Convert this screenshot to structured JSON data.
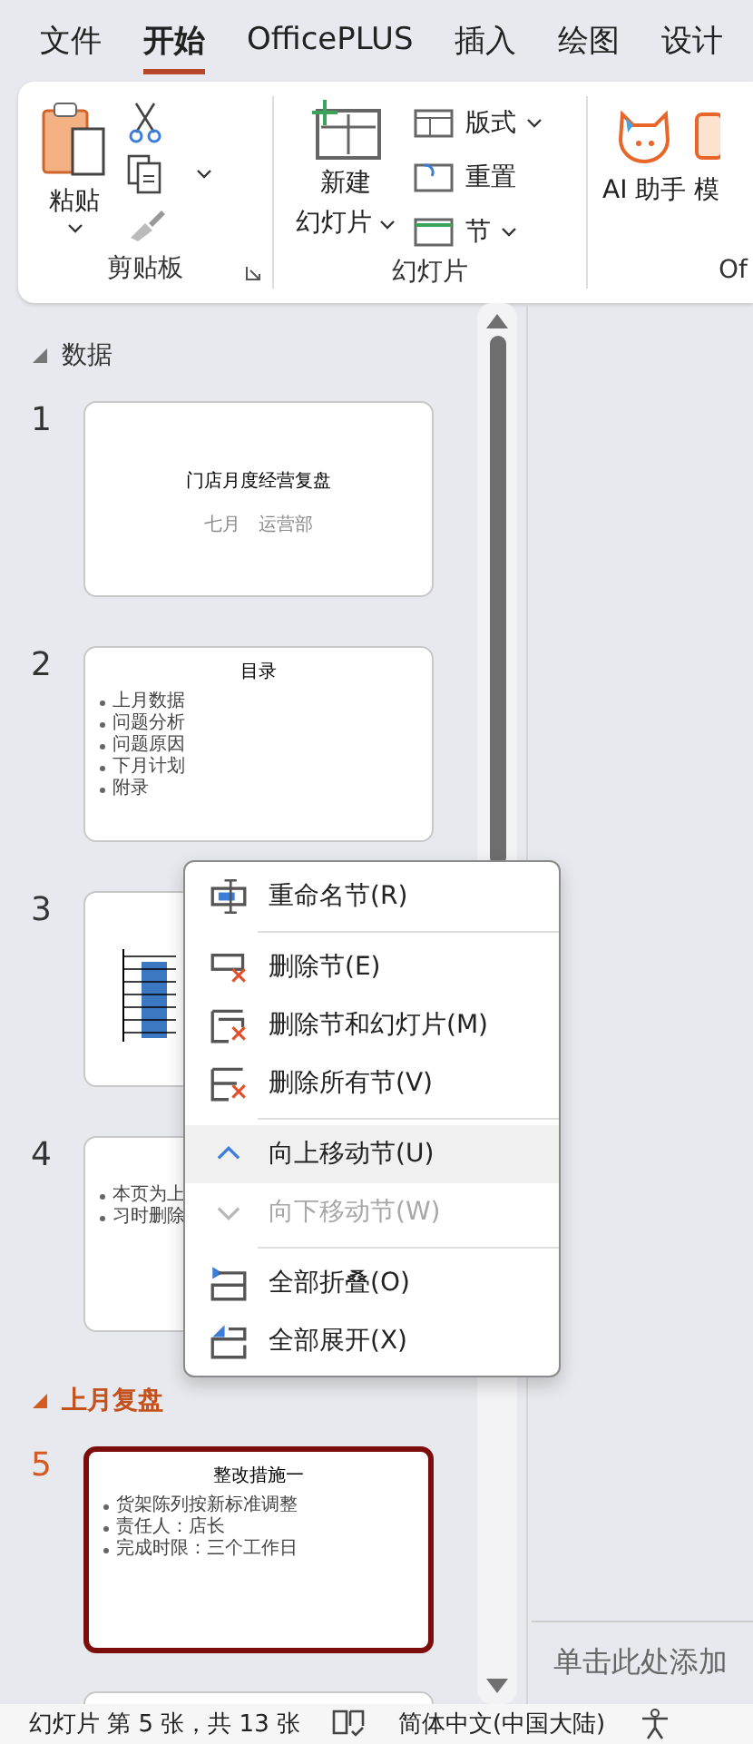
{
  "tabs": [
    {
      "label": "文件",
      "selected": false
    },
    {
      "label": "开始",
      "selected": true
    },
    {
      "label": "OfficePLUS",
      "selected": false
    },
    {
      "label": "插入",
      "selected": false
    },
    {
      "label": "绘图",
      "selected": false
    },
    {
      "label": "设计",
      "selected": false
    }
  ],
  "ribbon": {
    "groups": [
      {
        "kind": "clipboard",
        "label": "剪贴板",
        "paste": "粘贴"
      },
      {
        "kind": "slides",
        "label": "幻灯片",
        "new_slide": [
          "新建",
          "幻灯片"
        ],
        "buttons": [
          "版式",
          "重置",
          "节"
        ]
      },
      {
        "kind": "ai",
        "label": "Of",
        "buttons": [
          "AI 助手",
          "模"
        ]
      }
    ]
  },
  "sections": [
    {
      "name": "数据",
      "selected": false,
      "slides": [
        {
          "number": "1",
          "kind": "title",
          "selected": false,
          "title": "门店月度经营复盘",
          "subtitle": "七月　运营部"
        },
        {
          "number": "2",
          "kind": "list",
          "selected": false,
          "title": "目录",
          "bullets": [
            "上月数据",
            "问题分析",
            "问题原因",
            "下月计划",
            "附录"
          ]
        },
        {
          "number": "3",
          "kind": "chart",
          "selected": false
        },
        {
          "number": "4",
          "kind": "note",
          "selected": false,
          "lines": [
            "本页为上",
            "习时删除"
          ]
        }
      ]
    },
    {
      "name": "上月复盘",
      "selected": true,
      "slides": [
        {
          "number": "5",
          "kind": "list",
          "selected": true,
          "title": "整改措施一",
          "bullets": [
            "货架陈列按新标准调整",
            "责任人：店长",
            "完成时限：三个工作日"
          ]
        },
        {
          "kind": "blank",
          "selected": false
        }
      ]
    }
  ],
  "context_menu": {
    "groups": [
      [
        {
          "kind": "rename",
          "label": "重命名节(R)",
          "disabled": false,
          "highlighted": false
        }
      ],
      [
        {
          "kind": "delete",
          "label": "删除节(E)",
          "disabled": false,
          "highlighted": false
        },
        {
          "kind": "delete-with-slides",
          "label": "删除节和幻灯片(M)",
          "disabled": false,
          "highlighted": false
        },
        {
          "kind": "delete-all",
          "label": "删除所有节(V)",
          "disabled": false,
          "highlighted": false
        }
      ],
      [
        {
          "kind": "up",
          "label": "向上移动节(U)",
          "disabled": false,
          "highlighted": true
        },
        {
          "kind": "down",
          "label": "向下移动节(W)",
          "disabled": true,
          "highlighted": false
        }
      ],
      [
        {
          "kind": "collapse",
          "label": "全部折叠(O)",
          "disabled": false,
          "highlighted": false
        },
        {
          "kind": "expand",
          "label": "全部展开(X)",
          "disabled": false,
          "highlighted": false
        }
      ]
    ]
  },
  "notes": {
    "placeholder": "单击此处添加"
  },
  "status_bar": {
    "slide_info": "幻灯片 第 5 张，共 13 张",
    "language": "简体中文(中国大陆)"
  }
}
